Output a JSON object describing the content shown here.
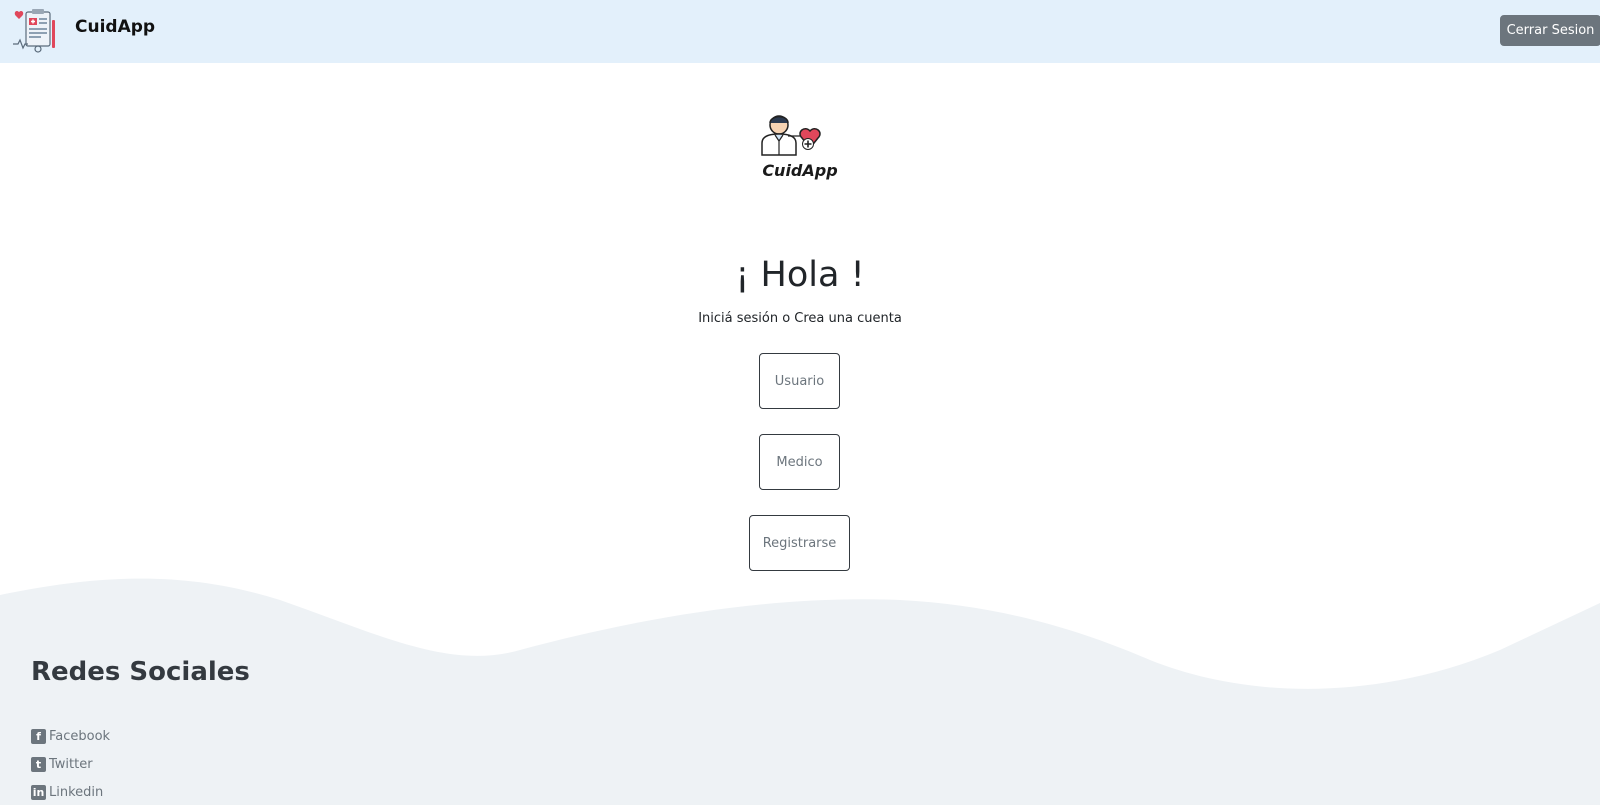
{
  "navbar": {
    "brand": "CuidApp",
    "logout_label": "Cerrar Sesion"
  },
  "hero": {
    "logo_text": "CuidApp",
    "greeting": "¡ Hola !",
    "subtitle": "Iniciá sesión o Crea una cuenta"
  },
  "actions": {
    "usuario": "Usuario",
    "medico": "Medico",
    "registrarse": "Registrarse"
  },
  "footer": {
    "title": "Redes Sociales",
    "links": [
      {
        "label": "Facebook",
        "icon": "facebook-icon"
      },
      {
        "label": "Twitter",
        "icon": "twitter-icon"
      },
      {
        "label": "Linkedin",
        "icon": "linkedin-icon"
      }
    ]
  },
  "colors": {
    "navbar_bg": "#e3f0fb",
    "logout_bg": "#6c757d",
    "footer_bg": "#eef2f5",
    "heart": "#e0475b"
  }
}
